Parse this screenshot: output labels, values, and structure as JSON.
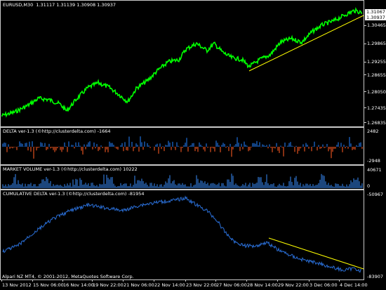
{
  "colors": {
    "background": "#000000",
    "grid_border": "#c8c8c8",
    "price_line": "#00ff00",
    "trendline": "#ffff00",
    "delta_up": "#1e6fd9",
    "delta_down": "#e0501e",
    "volume": "#2f74d0",
    "cum_delta": "#2a6fd8"
  },
  "price_pane": {
    "title": "EURUSD,M30  1.31117 1.31139 1.30908 1.30937",
    "current_price": "1.30937",
    "top_value": "1.31067",
    "axis_labels": [
      "1.30465",
      "1.29865",
      "1.29255",
      "1.28655",
      "1.28050",
      "1.27435",
      "1.26835"
    ]
  },
  "delta_pane": {
    "title": "DELTA ver-1.3 (©http://clusterdelta.com) -1664",
    "axis_top": "2482",
    "axis_bottom": "-2948"
  },
  "volume_pane": {
    "title": "MARKET VOLUME ver-1.3 (©http://clusterdelta.com) 10222",
    "axis_top": "40671",
    "axis_bottom": "0"
  },
  "cumdelta_pane": {
    "title": "CUMULATIVE DELTA ver-1.3 (©http://clusterdelta.com) -81954",
    "axis_top": "-50967",
    "axis_bottom": "-83907"
  },
  "copyright": "Alpari NZ MT4, © 2001-2012, MetaQuotes Software Corp.",
  "time_axis": [
    "13 Nov 2012",
    "15 Nov 06:00",
    "16 Nov 14:00",
    "19 Nov 22:00",
    "21 Nov 06:00",
    "22 Nov 14:00",
    "23 Nov 22:00",
    "27 Nov 06:00",
    "28 Nov 14:00",
    "29 Nov 22:00",
    "3 Dec 06:00",
    "4 Dec 14:00"
  ]
}
